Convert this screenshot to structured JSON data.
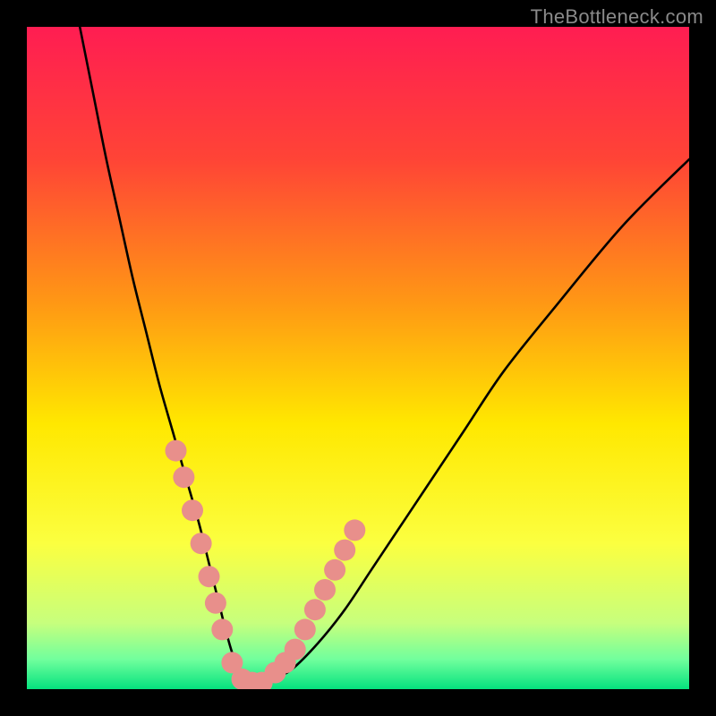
{
  "watermark": {
    "text": "TheBottleneck.com"
  },
  "chart_data": {
    "type": "line",
    "title": "",
    "xlabel": "",
    "ylabel": "",
    "xlim": [
      0,
      100
    ],
    "ylim": [
      0,
      100
    ],
    "grid": false,
    "background_gradient": {
      "direction": "vertical",
      "stops": [
        {
          "offset": 0.0,
          "color": "#ff1d52"
        },
        {
          "offset": 0.2,
          "color": "#ff4436"
        },
        {
          "offset": 0.42,
          "color": "#ff9914"
        },
        {
          "offset": 0.6,
          "color": "#ffe800"
        },
        {
          "offset": 0.78,
          "color": "#fbff40"
        },
        {
          "offset": 0.9,
          "color": "#c7ff7d"
        },
        {
          "offset": 0.955,
          "color": "#71ff9d"
        },
        {
          "offset": 1.0,
          "color": "#05e27e"
        }
      ]
    },
    "series": [
      {
        "name": "bottleneck-curve",
        "color": "#000000",
        "x": [
          8,
          10,
          12,
          14,
          16,
          18,
          20,
          22,
          24,
          26,
          27.5,
          29,
          30,
          31,
          32,
          33.5,
          35,
          37,
          40,
          44,
          48,
          52,
          56,
          60,
          66,
          72,
          80,
          90,
          100
        ],
        "y": [
          100,
          90,
          80,
          71,
          62,
          54,
          46,
          39,
          32,
          25,
          19,
          13,
          9,
          5.5,
          3,
          1.5,
          1,
          1.5,
          3,
          7,
          12,
          18,
          24,
          30,
          39,
          48,
          58,
          70,
          80
        ]
      }
    ],
    "scatter_overlay": {
      "name": "highlighted-range-dots",
      "color": "#e88f8b",
      "radius_px": 12,
      "points": [
        {
          "x": 22.5,
          "y": 36
        },
        {
          "x": 23.7,
          "y": 32
        },
        {
          "x": 25.0,
          "y": 27
        },
        {
          "x": 26.3,
          "y": 22
        },
        {
          "x": 27.5,
          "y": 17
        },
        {
          "x": 28.5,
          "y": 13
        },
        {
          "x": 29.5,
          "y": 9
        },
        {
          "x": 31.0,
          "y": 4
        },
        {
          "x": 32.5,
          "y": 1.5
        },
        {
          "x": 34.0,
          "y": 1
        },
        {
          "x": 35.5,
          "y": 1
        },
        {
          "x": 37.5,
          "y": 2.5
        },
        {
          "x": 39.0,
          "y": 4
        },
        {
          "x": 40.5,
          "y": 6
        },
        {
          "x": 42.0,
          "y": 9
        },
        {
          "x": 43.5,
          "y": 12
        },
        {
          "x": 45.0,
          "y": 15
        },
        {
          "x": 46.5,
          "y": 18
        },
        {
          "x": 48.0,
          "y": 21
        },
        {
          "x": 49.5,
          "y": 24
        }
      ]
    }
  }
}
